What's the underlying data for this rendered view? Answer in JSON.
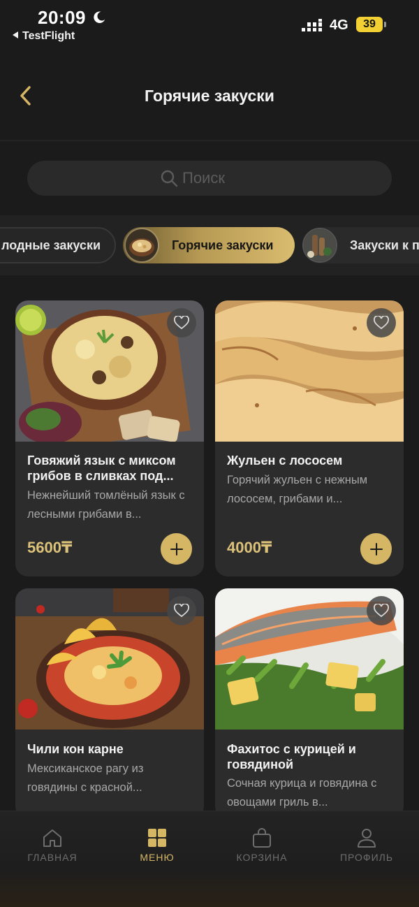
{
  "status_bar": {
    "time": "20:09",
    "back_app": "TestFlight",
    "network": "4G",
    "battery": "39"
  },
  "header": {
    "title": "Горячие закуски"
  },
  "search": {
    "placeholder": "Поиск"
  },
  "categories": [
    {
      "label": "Холодные закуски",
      "visible_label": "лодные закуски",
      "selected": false
    },
    {
      "label": "Горячие закуски",
      "selected": true
    },
    {
      "label": "Закуски к пиву",
      "visible_label": "Закуски к п",
      "selected": false
    }
  ],
  "products": [
    {
      "title": "Говяжий язык с миксом грибов в сливках под...",
      "description": "Нежнейший томлёный язык с лесными грибами в...",
      "price": "5600₸",
      "favorite": false
    },
    {
      "title": "Жульен с лососем",
      "description": "Горячий жульен с нежным лососем, грибами и...",
      "price": "4000₸",
      "favorite": false
    },
    {
      "title": "Чили кон карне",
      "description": "Мексиканское рагу из говядины с красной...",
      "favorite": false
    },
    {
      "title": "Фахитос с курицей и говядиной",
      "description": "Сочная курица и говядина с овощами гриль в...",
      "favorite": false
    }
  ],
  "bottom_nav": [
    {
      "label": "ГЛАВНАЯ",
      "icon": "home-icon",
      "active": false
    },
    {
      "label": "МЕНЮ",
      "icon": "menu-grid-icon",
      "active": true
    },
    {
      "label": "КОРЗИНА",
      "icon": "bag-icon",
      "active": false
    },
    {
      "label": "ПРОФИЛЬ",
      "icon": "user-icon",
      "active": false
    }
  ],
  "colors": {
    "background": "#1b1b1b",
    "card": "#2c2c2c",
    "accent_gold": "#d4b665",
    "price_gold": "#ddc27a",
    "muted_text": "#a8a8a8"
  }
}
